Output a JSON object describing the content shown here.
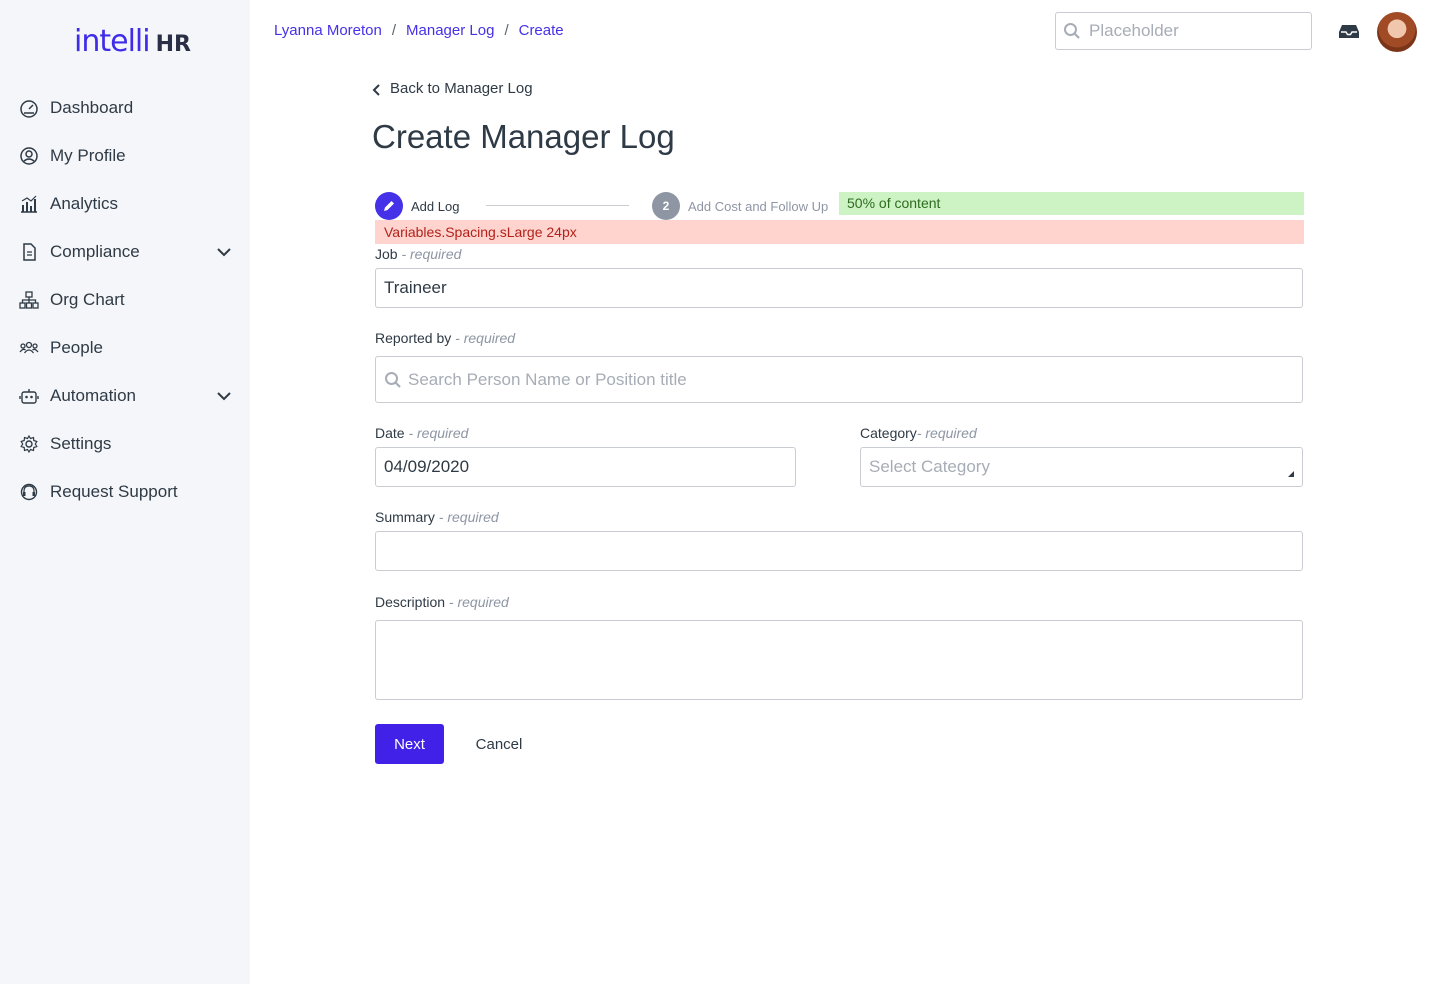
{
  "brand": {
    "part1": "intelli",
    "part2": "HR"
  },
  "sidebar": {
    "items": [
      {
        "label": "Dashboard",
        "icon": "dashboard-icon",
        "expandable": false
      },
      {
        "label": "My Profile",
        "icon": "user-circle-icon",
        "expandable": false
      },
      {
        "label": "Analytics",
        "icon": "chart-icon",
        "expandable": false
      },
      {
        "label": "Compliance",
        "icon": "document-icon",
        "expandable": true
      },
      {
        "label": "Org Chart",
        "icon": "org-chart-icon",
        "expandable": false
      },
      {
        "label": "People",
        "icon": "people-icon",
        "expandable": false
      },
      {
        "label": "Automation",
        "icon": "robot-icon",
        "expandable": true
      },
      {
        "label": "Settings",
        "icon": "gear-icon",
        "expandable": false
      },
      {
        "label": "Request Support",
        "icon": "headset-icon",
        "expandable": false
      }
    ]
  },
  "breadcrumb": {
    "items": [
      "Lyanna Moreton",
      "Manager Log",
      "Create"
    ],
    "separator": "/"
  },
  "search": {
    "placeholder": "Placeholder"
  },
  "page": {
    "back_link": "Back to Manager Log",
    "title": "Create Manager Log"
  },
  "steps": [
    {
      "number": "",
      "label": "Add Log",
      "state": "active"
    },
    {
      "number": "2",
      "label": "Add Cost and Follow Up",
      "state": "inactive"
    }
  ],
  "annotations": {
    "green": "50% of content",
    "red": "Variables.Spacing.sLarge 24px"
  },
  "form": {
    "job": {
      "label": "Job",
      "required": " - required",
      "value": "Traineer"
    },
    "reported_by": {
      "label": "Reported by",
      "required": " - required",
      "placeholder": "Search Person Name or Position title"
    },
    "date": {
      "label": "Date",
      "required": " - required",
      "value": "04/09/2020"
    },
    "category": {
      "label": "Category",
      "required": "- required",
      "placeholder": "Select Category"
    },
    "summary": {
      "label": "Summary",
      "required": " - required",
      "value": ""
    },
    "description": {
      "label": "Description",
      "required": " - required",
      "value": ""
    }
  },
  "actions": {
    "next": "Next",
    "cancel": "Cancel"
  },
  "colors": {
    "accent": "#4531e8",
    "button": "#4120e8",
    "annot_green": "#cdf3c4",
    "annot_red": "#ffd4cf"
  }
}
